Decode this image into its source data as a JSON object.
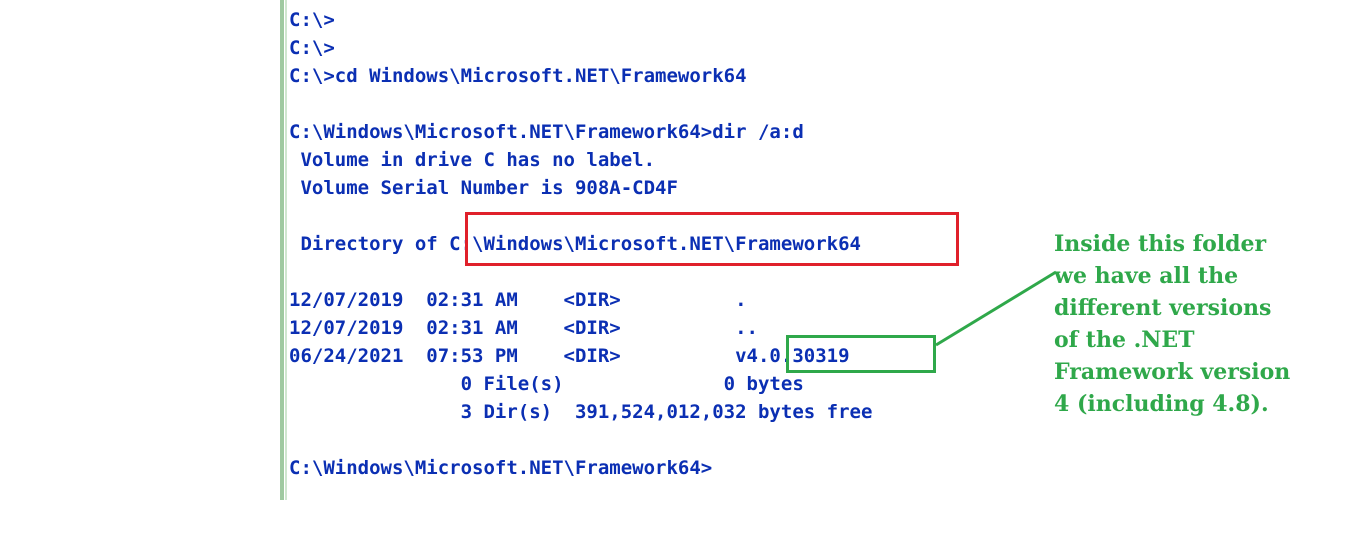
{
  "console": {
    "lines": [
      "C:\\>",
      "C:\\>",
      "C:\\>cd Windows\\Microsoft.NET\\Framework64",
      "",
      "C:\\Windows\\Microsoft.NET\\Framework64>dir /a:d",
      " Volume in drive C has no label.",
      " Volume Serial Number is 908A-CD4F",
      "",
      " Directory of C:\\Windows\\Microsoft.NET\\Framework64",
      "",
      "12/07/2019  02:31 AM    <DIR>          .",
      "12/07/2019  02:31 AM    <DIR>          ..",
      "06/24/2021  07:53 PM    <DIR>          v4.0.30319",
      "               0 File(s)              0 bytes",
      "               3 Dir(s)  391,524,012,032 bytes free",
      "",
      "C:\\Windows\\Microsoft.NET\\Framework64>"
    ]
  },
  "annotation": {
    "note_lines": [
      "Inside this folder",
      "we have all the",
      "different versions",
      "of the .NET",
      "Framework version",
      "4 (including 4.8)."
    ],
    "red_color": "#e0202a",
    "green_color": "#2fa84a"
  }
}
